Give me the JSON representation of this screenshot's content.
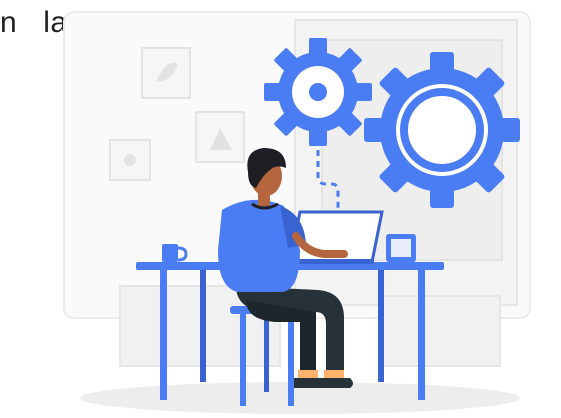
{
  "caption": {
    "word1": "n",
    "word2": "la"
  },
  "colors": {
    "accent": "#4a7cf3",
    "accent_dark": "#3a63d2",
    "skin": "#b5663f",
    "hair": "#1e1e24",
    "pants": "#263238",
    "backdrop": "#f4f4f4",
    "shadow": "#ececec"
  },
  "icons": {
    "small_gear": "gear-icon",
    "large_gear": "gear-icon",
    "monitor": "laptop-icon",
    "cup": "mug-icon",
    "tablet": "tablet-icon"
  }
}
